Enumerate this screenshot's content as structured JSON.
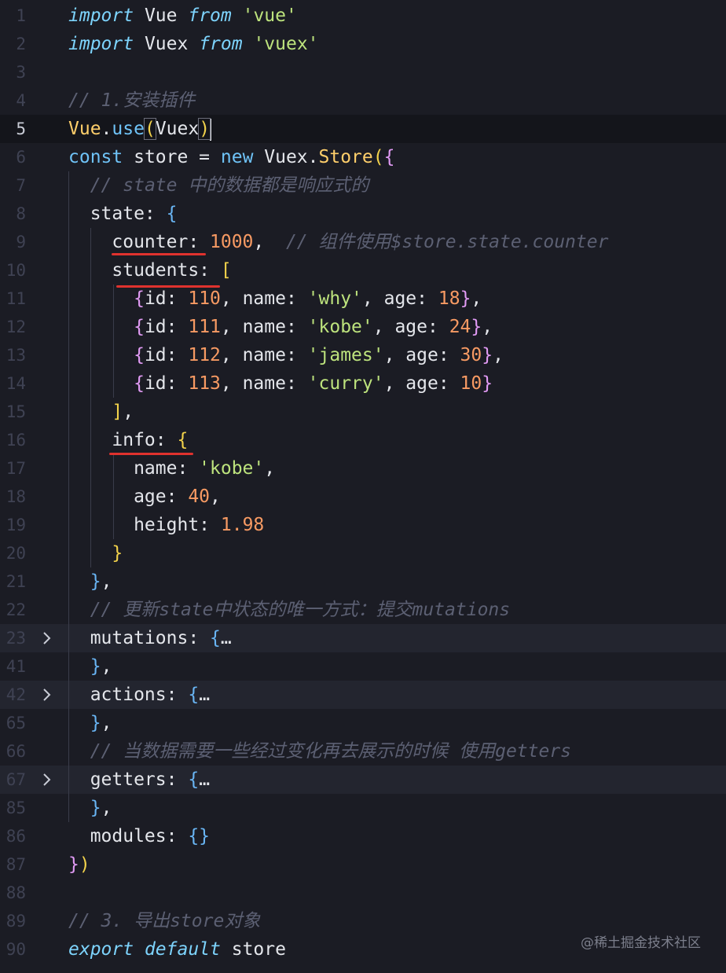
{
  "editor": {
    "language": "javascript",
    "active_line": "5",
    "lines": [
      {
        "num": "1",
        "parts": [
          [
            "kw",
            "import"
          ],
          [
            "pl",
            " Vue "
          ],
          [
            "kw",
            "from"
          ],
          [
            "pl",
            " "
          ],
          [
            "str",
            "'vue'"
          ]
        ]
      },
      {
        "num": "2",
        "parts": [
          [
            "kw",
            "import"
          ],
          [
            "pl",
            " Vuex "
          ],
          [
            "kw",
            "from"
          ],
          [
            "pl",
            " "
          ],
          [
            "str",
            "'vuex'"
          ]
        ]
      },
      {
        "num": "3",
        "parts": []
      },
      {
        "num": "4",
        "parts": [
          [
            "cmt",
            "// 1.安装插件"
          ]
        ]
      },
      {
        "num": "5",
        "parts": [
          [
            "fn",
            "Vue"
          ],
          [
            "pl",
            "."
          ],
          [
            "kwn",
            "use"
          ],
          [
            "br1",
            "("
          ],
          [
            "pl",
            "Vuex"
          ],
          [
            "br1",
            ")"
          ]
        ]
      },
      {
        "num": "6",
        "parts": [
          [
            "kwn",
            "const"
          ],
          [
            "pl",
            " store = "
          ],
          [
            "kwn",
            "new"
          ],
          [
            "pl",
            " Vuex."
          ],
          [
            "fn",
            "Store"
          ],
          [
            "br1",
            "("
          ],
          [
            "br2",
            "{"
          ]
        ]
      },
      {
        "num": "7",
        "parts": [
          [
            "pl",
            "  "
          ],
          [
            "cmt",
            "// state 中的数据都是响应式的"
          ]
        ]
      },
      {
        "num": "8",
        "parts": [
          [
            "pl",
            "  state: "
          ],
          [
            "br3",
            "{"
          ]
        ]
      },
      {
        "num": "9",
        "parts": [
          [
            "pl",
            "    counter: "
          ],
          [
            "num",
            "1000"
          ],
          [
            "pl",
            ",  "
          ],
          [
            "cmt",
            "// 组件使用$store.state.counter"
          ]
        ]
      },
      {
        "num": "10",
        "parts": [
          [
            "pl",
            "    students: "
          ],
          [
            "br1",
            "["
          ]
        ]
      },
      {
        "num": "11",
        "parts": [
          [
            "pl",
            "      "
          ],
          [
            "br2",
            "{"
          ],
          [
            "pl",
            "id: "
          ],
          [
            "num",
            "110"
          ],
          [
            "pl",
            ", name: "
          ],
          [
            "str",
            "'why'"
          ],
          [
            "pl",
            ", age: "
          ],
          [
            "num",
            "18"
          ],
          [
            "br2",
            "}"
          ],
          [
            "pl",
            ","
          ]
        ]
      },
      {
        "num": "12",
        "parts": [
          [
            "pl",
            "      "
          ],
          [
            "br2",
            "{"
          ],
          [
            "pl",
            "id: "
          ],
          [
            "num",
            "111"
          ],
          [
            "pl",
            ", name: "
          ],
          [
            "str",
            "'kobe'"
          ],
          [
            "pl",
            ", age: "
          ],
          [
            "num",
            "24"
          ],
          [
            "br2",
            "}"
          ],
          [
            "pl",
            ","
          ]
        ]
      },
      {
        "num": "13",
        "parts": [
          [
            "pl",
            "      "
          ],
          [
            "br2",
            "{"
          ],
          [
            "pl",
            "id: "
          ],
          [
            "num",
            "112"
          ],
          [
            "pl",
            ", name: "
          ],
          [
            "str",
            "'james'"
          ],
          [
            "pl",
            ", age: "
          ],
          [
            "num",
            "30"
          ],
          [
            "br2",
            "}"
          ],
          [
            "pl",
            ","
          ]
        ]
      },
      {
        "num": "14",
        "parts": [
          [
            "pl",
            "      "
          ],
          [
            "br2",
            "{"
          ],
          [
            "pl",
            "id: "
          ],
          [
            "num",
            "113"
          ],
          [
            "pl",
            ", name: "
          ],
          [
            "str",
            "'curry'"
          ],
          [
            "pl",
            ", age: "
          ],
          [
            "num",
            "10"
          ],
          [
            "br2",
            "}"
          ]
        ]
      },
      {
        "num": "15",
        "parts": [
          [
            "pl",
            "    "
          ],
          [
            "br1",
            "]"
          ],
          [
            "pl",
            ","
          ]
        ]
      },
      {
        "num": "16",
        "parts": [
          [
            "pl",
            "    info: "
          ],
          [
            "br1",
            "{"
          ]
        ]
      },
      {
        "num": "17",
        "parts": [
          [
            "pl",
            "      name: "
          ],
          [
            "str",
            "'kobe'"
          ],
          [
            "pl",
            ","
          ]
        ]
      },
      {
        "num": "18",
        "parts": [
          [
            "pl",
            "      age: "
          ],
          [
            "num",
            "40"
          ],
          [
            "pl",
            ","
          ]
        ]
      },
      {
        "num": "19",
        "parts": [
          [
            "pl",
            "      height: "
          ],
          [
            "num",
            "1.98"
          ]
        ]
      },
      {
        "num": "20",
        "parts": [
          [
            "pl",
            "    "
          ],
          [
            "br1",
            "}"
          ]
        ]
      },
      {
        "num": "21",
        "parts": [
          [
            "pl",
            "  "
          ],
          [
            "br3",
            "}"
          ],
          [
            "pl",
            ","
          ]
        ]
      },
      {
        "num": "22",
        "parts": [
          [
            "pl",
            "  "
          ],
          [
            "cmt",
            "// 更新state中状态的唯一方式：提交mutations"
          ]
        ]
      },
      {
        "num": "23",
        "fold": true,
        "parts": [
          [
            "pl",
            "  mutations: "
          ],
          [
            "br3",
            "{"
          ],
          [
            "pl",
            "…"
          ]
        ]
      },
      {
        "num": "41",
        "parts": [
          [
            "pl",
            "  "
          ],
          [
            "br3",
            "}"
          ],
          [
            "pl",
            ","
          ]
        ]
      },
      {
        "num": "42",
        "fold": true,
        "parts": [
          [
            "pl",
            "  actions: "
          ],
          [
            "br3",
            "{"
          ],
          [
            "pl",
            "…"
          ]
        ]
      },
      {
        "num": "65",
        "parts": [
          [
            "pl",
            "  "
          ],
          [
            "br3",
            "}"
          ],
          [
            "pl",
            ","
          ]
        ]
      },
      {
        "num": "66",
        "parts": [
          [
            "pl",
            "  "
          ],
          [
            "cmt",
            "// 当数据需要一些经过变化再去展示的时候 使用getters"
          ]
        ]
      },
      {
        "num": "67",
        "fold": true,
        "parts": [
          [
            "pl",
            "  getters: "
          ],
          [
            "br3",
            "{"
          ],
          [
            "pl",
            "…"
          ]
        ]
      },
      {
        "num": "85",
        "parts": [
          [
            "pl",
            "  "
          ],
          [
            "br3",
            "}"
          ],
          [
            "pl",
            ","
          ]
        ]
      },
      {
        "num": "86",
        "parts": [
          [
            "pl",
            "  modules: "
          ],
          [
            "br3",
            "{}"
          ]
        ]
      },
      {
        "num": "87",
        "parts": [
          [
            "br2",
            "}"
          ],
          [
            "br1",
            ")"
          ]
        ]
      },
      {
        "num": "88",
        "parts": []
      },
      {
        "num": "89",
        "parts": [
          [
            "cmt",
            "// 3. 导出store对象"
          ]
        ]
      },
      {
        "num": "90",
        "parts": [
          [
            "kw",
            "export"
          ],
          [
            "pl",
            " "
          ],
          [
            "kw",
            "default"
          ],
          [
            "pl",
            " store"
          ]
        ]
      }
    ]
  },
  "fold_icon": "chevron-right-icon",
  "watermark": "@稀土掘金技术社区",
  "colors": {
    "background": "#1b1c24",
    "keyword": "#7dd3fc",
    "string": "#bde37d",
    "number": "#f79a63",
    "comment": "#5c6073",
    "annotation_underline": "#e0322e"
  }
}
